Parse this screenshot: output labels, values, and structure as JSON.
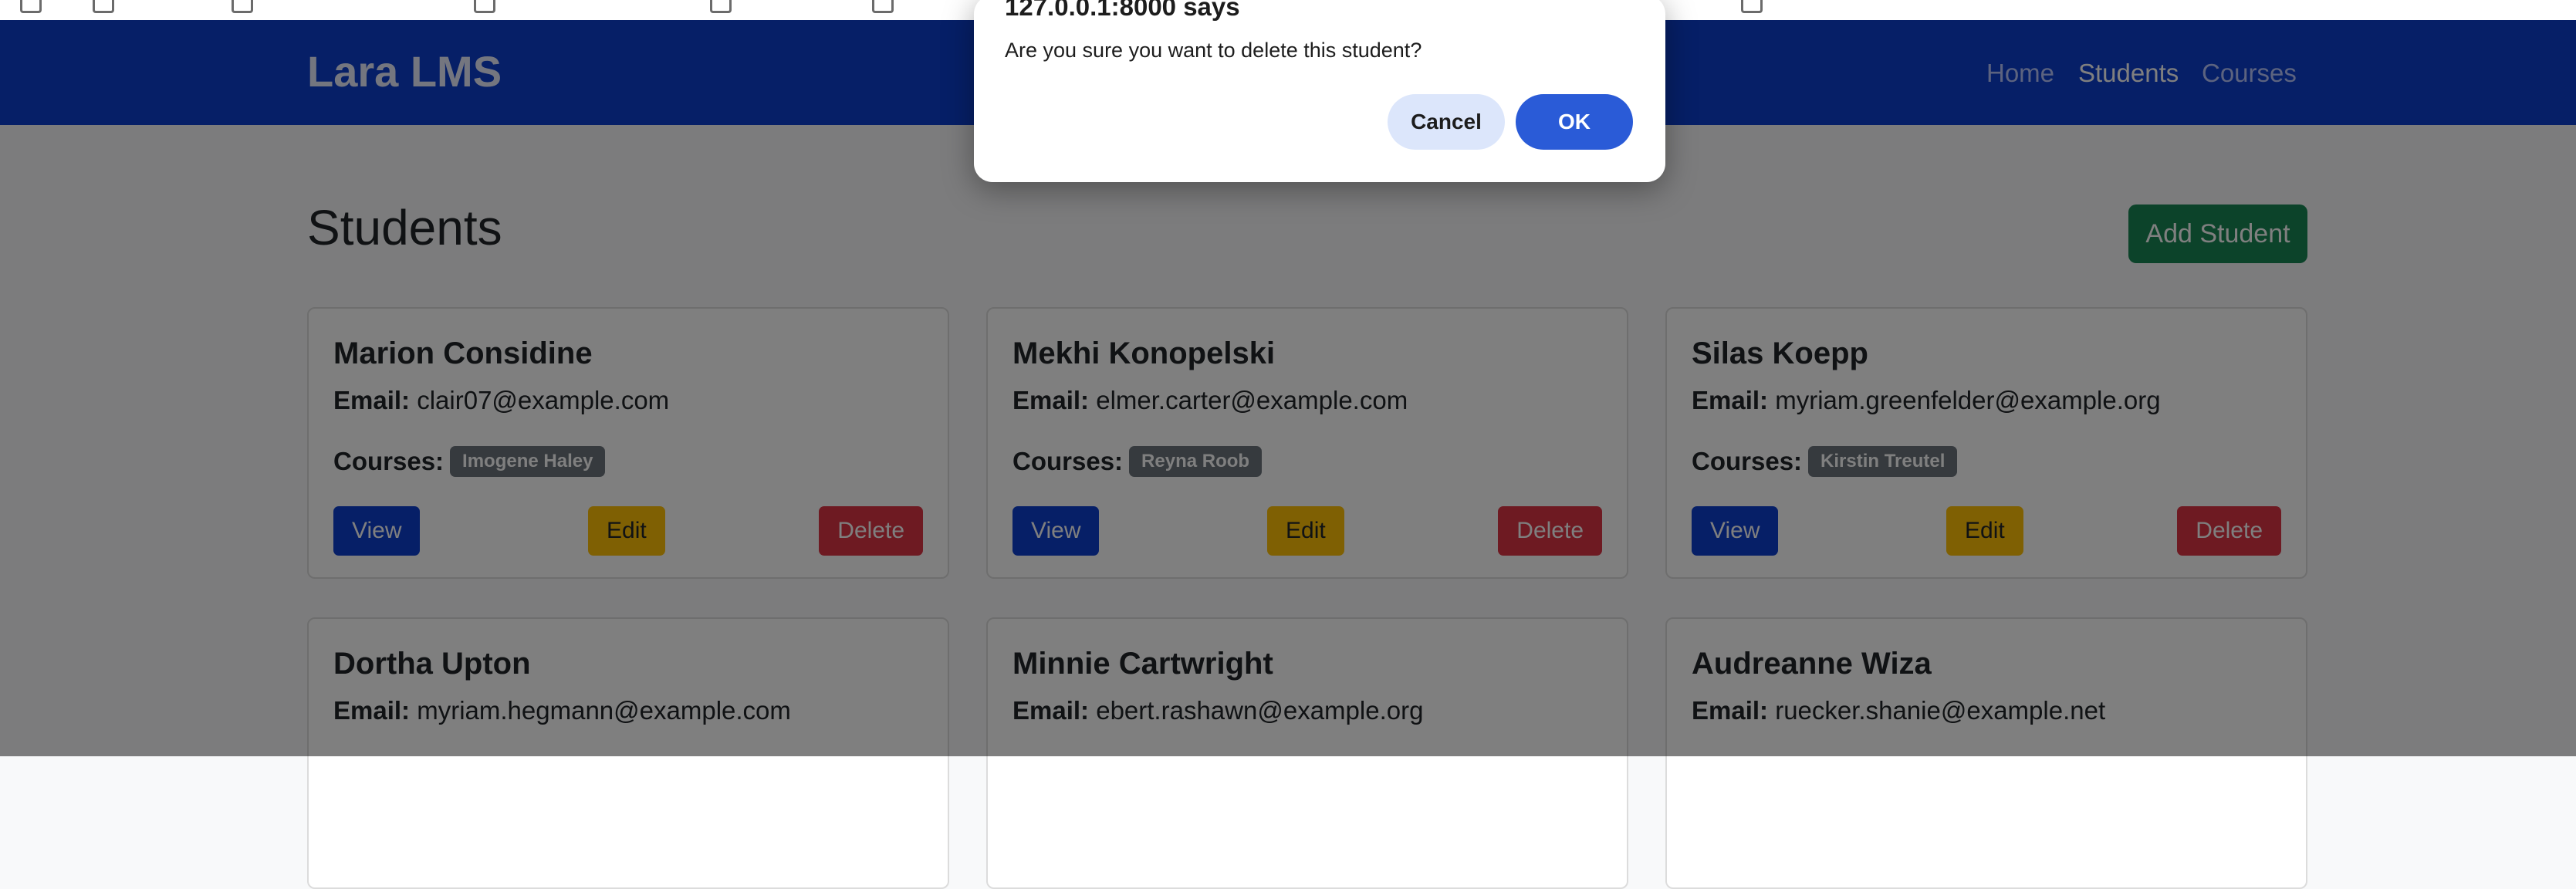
{
  "app": {
    "brand": "Lara LMS",
    "nav": [
      {
        "label": "Home"
      },
      {
        "label": "Students"
      },
      {
        "label": "Courses"
      }
    ]
  },
  "page": {
    "title": "Students",
    "add_button": "Add Student"
  },
  "labels": {
    "email": "Email:",
    "courses": "Courses:",
    "view": "View",
    "edit": "Edit",
    "delete": "Delete"
  },
  "students": [
    {
      "name": "Marion Considine",
      "email": "clair07@example.com",
      "course": "Imogene Haley"
    },
    {
      "name": "Mekhi Konopelski",
      "email": "elmer.carter@example.com",
      "course": "Reyna Roob"
    },
    {
      "name": "Silas Koepp",
      "email": "myriam.greenfelder@example.org",
      "course": "Kirstin Treutel"
    },
    {
      "name": "Dortha Upton",
      "email": "myriam.hegmann@example.com"
    },
    {
      "name": "Minnie Cartwright",
      "email": "ebert.rashawn@example.org"
    },
    {
      "name": "Audreanne Wiza",
      "email": "ruecker.shanie@example.net"
    }
  ],
  "dialog": {
    "title": "127.0.0.1:8000 says",
    "message": "Are you sure you want to delete this student?",
    "cancel": "Cancel",
    "ok": "OK"
  },
  "colors": {
    "navbar": "#0d3ecf",
    "success": "#198754",
    "primary": "#0d3ecf",
    "warning": "#ffc107",
    "danger": "#dc3545",
    "badge": "#6c757d"
  }
}
